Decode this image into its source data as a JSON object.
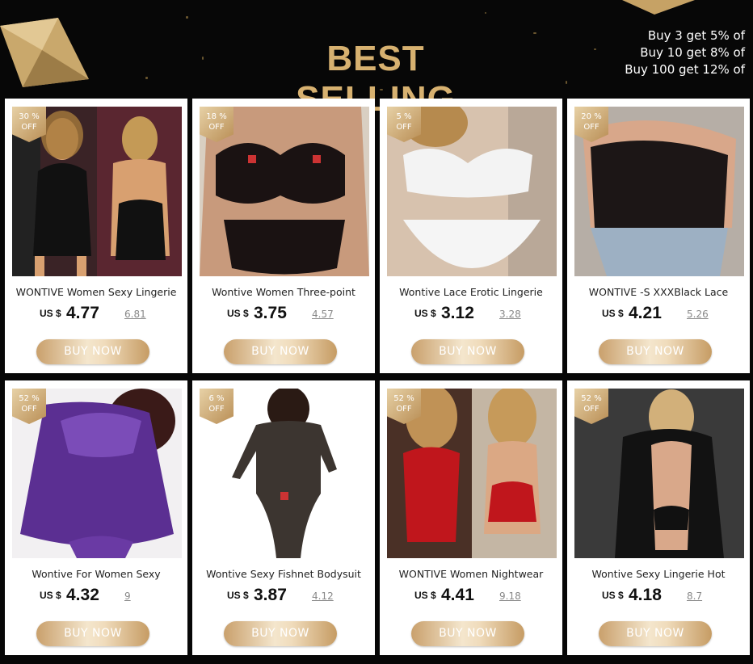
{
  "header": {
    "title": "BEST SELLING",
    "promo_lines": [
      "Buy 3 get 5% of",
      "Buy 10 get 8% of",
      "Buy 100 get 12% of"
    ]
  },
  "buy_label": "BUY NOW",
  "colors": {
    "gold": "#d7b170",
    "background": "#070707",
    "card": "#ffffff"
  },
  "products": [
    {
      "discount": "30 %",
      "off": "OFF",
      "name": "WONTIVE Women Sexy Lingerie",
      "currency": "US $",
      "price": "4.77",
      "old_price": "6.81"
    },
    {
      "discount": "18 %",
      "off": "OFF",
      "name": "Wontive Women Three-point",
      "currency": "US $",
      "price": "3.75",
      "old_price": "4.57"
    },
    {
      "discount": "5 %",
      "off": "OFF",
      "name": "Wontive Lace Erotic Lingerie",
      "currency": "US $",
      "price": "3.12",
      "old_price": "3.28"
    },
    {
      "discount": "20 %",
      "off": "OFF",
      "name": "WONTIVE -S XXXBlack Lace",
      "currency": "US $",
      "price": "4.21",
      "old_price": "5.26"
    },
    {
      "discount": "52 %",
      "off": "OFF",
      "name": "Wontive For Women Sexy",
      "currency": "US $",
      "price": "4.32",
      "old_price": "9"
    },
    {
      "discount": "6 %",
      "off": "OFF",
      "name": "Wontive Sexy Fishnet Bodysuit",
      "currency": "US $",
      "price": "3.87",
      "old_price": "4.12"
    },
    {
      "discount": "52 %",
      "off": "OFF",
      "name": "WONTIVE Women Nightwear",
      "currency": "US $",
      "price": "4.41",
      "old_price": "9.18"
    },
    {
      "discount": "52 %",
      "off": "OFF",
      "name": "Wontive Sexy Lingerie Hot",
      "currency": "US $",
      "price": "4.18",
      "old_price": "8.7"
    }
  ]
}
